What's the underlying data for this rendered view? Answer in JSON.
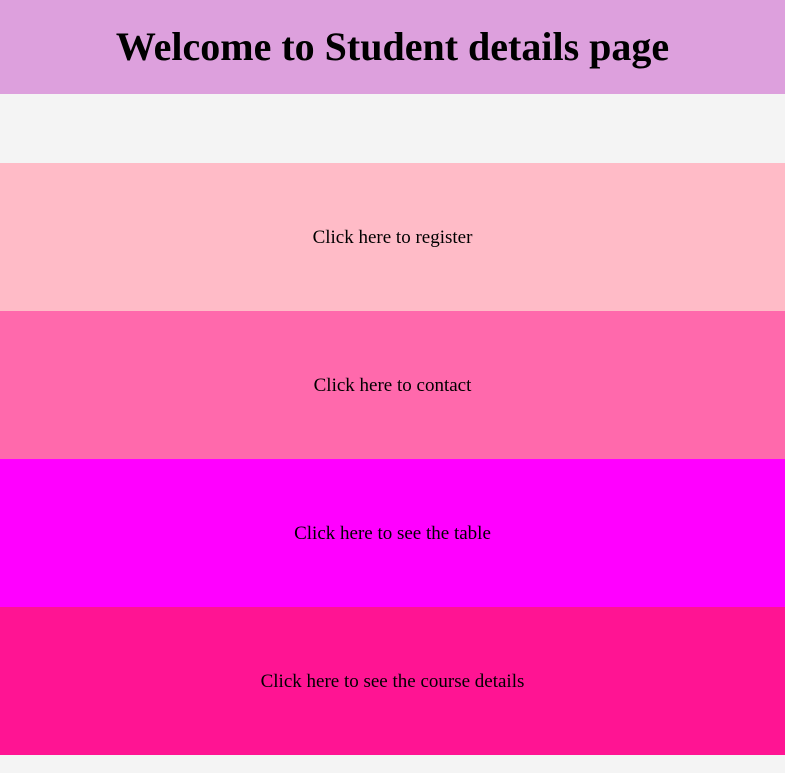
{
  "colors": {
    "page_background": "#f4f4f4",
    "header_background": "#dda0dd",
    "text": "#000000"
  },
  "header": {
    "title": "Welcome to Student details page"
  },
  "nav": {
    "items": [
      {
        "label": "Click here to register",
        "color": "#ffbbc7"
      },
      {
        "label": "Click here to contact",
        "color": "#ff69ac"
      },
      {
        "label": "Click here to see the table",
        "color": "#ff00ff"
      },
      {
        "label": "Click here to see the course details",
        "color": "#ff1493"
      }
    ]
  }
}
